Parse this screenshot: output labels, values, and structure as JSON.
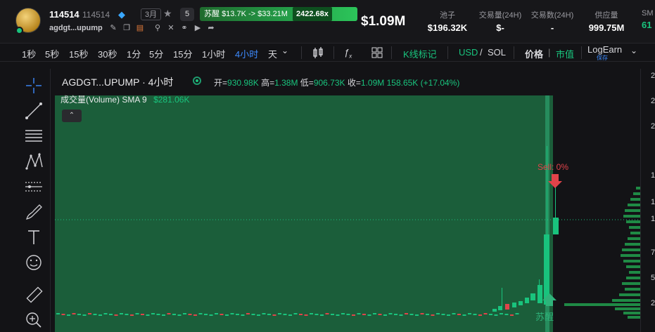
{
  "header": {
    "token_name": "114514",
    "token_symbol": "114514",
    "age_badge": "3月",
    "count_badge": "5",
    "wake": {
      "label": "苏醒",
      "mc_from": "$13.7K",
      "arrow": "->",
      "mc_to": "$33.21M",
      "multiplier": "2422.68x"
    },
    "address": "agdgt...upump",
    "price": "$1.09M",
    "stats": [
      {
        "label": "池子",
        "value": "$196.32K"
      },
      {
        "label": "交易量(24H)",
        "value": "$-"
      },
      {
        "label": "交易数(24H)",
        "value": "-"
      },
      {
        "label": "供应量",
        "value": "999.75M"
      },
      {
        "label": "SM",
        "value": "61"
      }
    ]
  },
  "toolbar": {
    "intervals": [
      "1秒",
      "5秒",
      "15秒",
      "30秒",
      "1分",
      "5分",
      "15分",
      "1小时",
      "4小时",
      "天"
    ],
    "active_interval": "4小时",
    "kline_marker": "K线标记",
    "usd": "USD",
    "slash": "/",
    "sol": "SOL",
    "price": "价格",
    "pipe": "|",
    "mcap": "市值",
    "logearn": "LogEarn",
    "save": "保存"
  },
  "chart_header": {
    "title": "AGDGT...UPUMP · 4小时",
    "open_label": "开=",
    "open": "930.98K",
    "high_label": "高=",
    "high": "1.38M",
    "low_label": "低=",
    "low": "906.73K",
    "close_label": "收=",
    "close": "1.09M",
    "change": "158.65K (+17.04%)",
    "volume_label": "成交量(Volume)",
    "sma_label": "SMA 9",
    "sma_value": "$281.06K"
  },
  "markers": {
    "sell": "Sell: 0%",
    "wake": "苏醒"
  },
  "right_axis_labels": [
    "2",
    "2",
    "2",
    "1",
    "1",
    "1",
    "7",
    "5",
    "2"
  ],
  "colors": {
    "up": "#19c37d",
    "down": "#e0434a",
    "volume_fill": "#1b5e3a",
    "accent": "#3d8bff"
  },
  "chart_data": {
    "type": "candlestick",
    "title": "AGDGT...UPUMP · 4小时",
    "latest": {
      "open": "930.98K",
      "high": "1.38M",
      "low": "906.73K",
      "close": "1.09M",
      "change": "+17.04%"
    },
    "sma9_volume": "$281.06K"
  }
}
